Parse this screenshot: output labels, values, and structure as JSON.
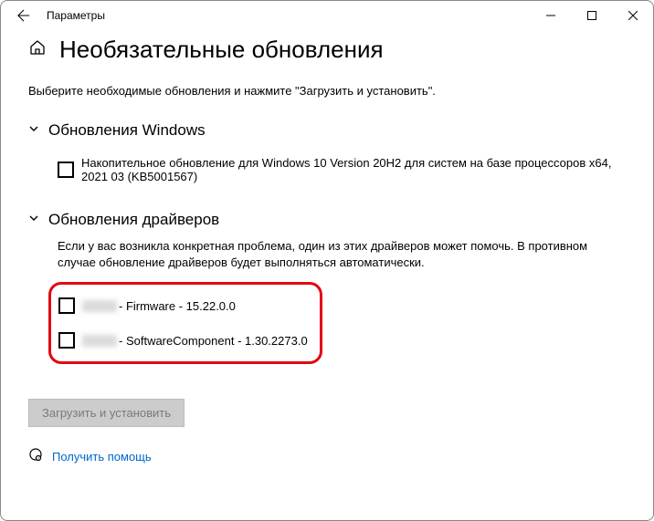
{
  "window": {
    "title": "Параметры"
  },
  "page": {
    "title": "Необязательные обновления",
    "instruction": "Выберите необходимые обновления и нажмите \"Загрузить и установить\"."
  },
  "sections": {
    "windows": {
      "title": "Обновления Windows",
      "items": [
        {
          "label": "Накопительное обновление для Windows 10 Version 20H2 для систем на базе процессоров x64, 2021 03 (KB5001567)"
        }
      ]
    },
    "drivers": {
      "title": "Обновления драйверов",
      "description": "Если у вас возникла конкретная проблема, один из этих драйверов может помочь. В противном случае обновление драйверов будет выполняться автоматически.",
      "items": [
        {
          "suffix": " - Firmware - 15.22.0.0"
        },
        {
          "suffix": " - SoftwareComponent - 1.30.2273.0"
        }
      ]
    }
  },
  "actions": {
    "download": "Загрузить и установить",
    "help": "Получить помощь"
  }
}
